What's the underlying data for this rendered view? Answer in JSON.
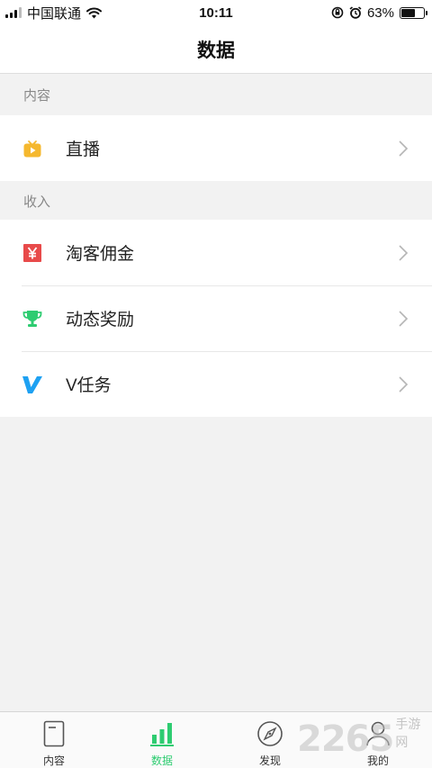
{
  "status_bar": {
    "carrier": "中国联通",
    "time": "10:11",
    "battery": "63%",
    "battery_level": 0.63
  },
  "header": {
    "title": "数据"
  },
  "sections": [
    {
      "title": "内容",
      "items": [
        {
          "label": "直播",
          "icon": "live-tv-icon",
          "color": "#f5b82e"
        }
      ]
    },
    {
      "title": "收入",
      "items": [
        {
          "label": "淘客佣金",
          "icon": "yen-icon",
          "color": "#e84a4a"
        },
        {
          "label": "动态奖励",
          "icon": "trophy-icon",
          "color": "#2ecc71"
        },
        {
          "label": "V任务",
          "icon": "v-icon",
          "color": "#1ea1f2"
        }
      ]
    }
  ],
  "tab_bar": {
    "tabs": [
      {
        "label": "内容",
        "icon": "document-icon",
        "active": false
      },
      {
        "label": "数据",
        "icon": "bar-chart-icon",
        "active": true
      },
      {
        "label": "发现",
        "icon": "compass-icon",
        "active": false
      },
      {
        "label": "我的",
        "icon": "person-icon",
        "active": false
      }
    ]
  },
  "watermark": {
    "number": "2265",
    "text": "手游网"
  },
  "colors": {
    "accent": "#2ecc71",
    "background": "#f2f2f2"
  }
}
